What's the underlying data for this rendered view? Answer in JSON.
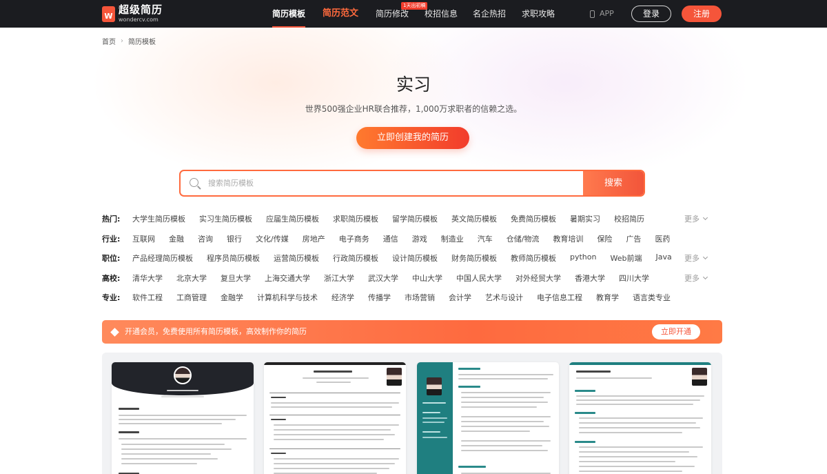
{
  "header": {
    "logo_cn": "超级简历",
    "logo_en": "wondercv.com",
    "logo_mark": "W",
    "nav": [
      {
        "label": "简历模板",
        "active": true
      },
      {
        "label": "简历范文",
        "highlight": true
      },
      {
        "label": "简历修改",
        "badge": "1天出初稿"
      },
      {
        "label": "校招信息"
      },
      {
        "label": "名企热招"
      },
      {
        "label": "求职攻略"
      }
    ],
    "app_label": "APP",
    "login_label": "登录",
    "register_label": "注册"
  },
  "breadcrumb": [
    "首页",
    "简历模板"
  ],
  "hero": {
    "title": "实习",
    "subtitle": "世界500强企业HR联合推荐，1,000万求职者的信赖之选。",
    "cta": "立即创建我的简历"
  },
  "search": {
    "placeholder": "搜索简历模板",
    "value": "",
    "button": "搜索"
  },
  "filters": {
    "more_label": "更多",
    "rows": [
      {
        "label": "热门:",
        "items": [
          "大学生简历模板",
          "实习生简历模板",
          "应届生简历模板",
          "求职简历模板",
          "留学简历模板",
          "英文简历模板",
          "免费简历模板",
          "暑期实习",
          "校招简历"
        ],
        "more": true
      },
      {
        "label": "行业:",
        "items": [
          "互联网",
          "金融",
          "咨询",
          "银行",
          "文化/传媒",
          "房地产",
          "电子商务",
          "通信",
          "游戏",
          "制造业",
          "汽车",
          "仓储/物流",
          "教育培训",
          "保险",
          "广告",
          "医药"
        ],
        "more": false
      },
      {
        "label": "职位:",
        "items": [
          "产品经理简历模板",
          "程序员简历模板",
          "运营简历模板",
          "行政简历模板",
          "设计简历模板",
          "财务简历模板",
          "教师简历模板",
          "python",
          "Web前端",
          "Java"
        ],
        "more": true
      },
      {
        "label": "高校:",
        "items": [
          "清华大学",
          "北京大学",
          "复旦大学",
          "上海交通大学",
          "浙江大学",
          "武汉大学",
          "中山大学",
          "中国人民大学",
          "对外经贸大学",
          "香港大学",
          "四川大学"
        ],
        "more": true
      },
      {
        "label": "专业:",
        "items": [
          "软件工程",
          "工商管理",
          "金融学",
          "计算机科学与技术",
          "经济学",
          "传播学",
          "市场营销",
          "会计学",
          "艺术与设计",
          "电子信息工程",
          "教育学",
          "语言类专业"
        ],
        "more": false
      }
    ]
  },
  "member": {
    "text": "开通会员，免费使用所有简历模板，高效制作你的简历",
    "button": "立即开通"
  },
  "templates": [
    {
      "style": "dark-header"
    },
    {
      "style": "classic-black"
    },
    {
      "style": "teal-sidebar"
    },
    {
      "style": "teal-top"
    }
  ],
  "colors": {
    "accent": "#f5553a",
    "header_bg": "#1b1c20",
    "teal": "#2a8a8a"
  }
}
